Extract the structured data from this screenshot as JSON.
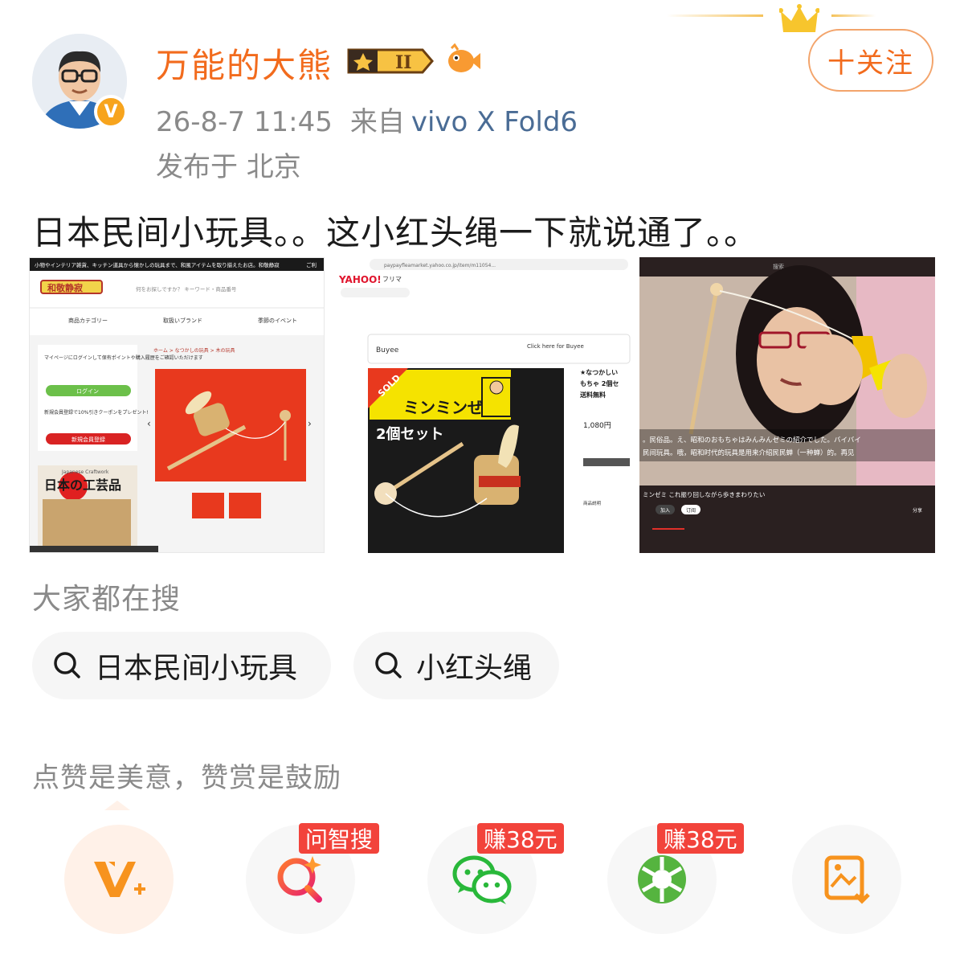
{
  "post": {
    "username": "万能的大熊",
    "level_label": "II",
    "time": "26-8-7 11:45",
    "source_prefix": "来自",
    "device": "vivo X Fold6",
    "location": "发布于 北京",
    "follow_label": "十关注",
    "content": "日本民间小玩具。。这小红头绳一下就说通了。。"
  },
  "images": {
    "img1": {
      "banner": "小物やインテリア雑貨、キッチン道具から懐かしの玩具まで、和風アイテムを取り揃えたお店。和敬静寂",
      "banner_right": "ご利",
      "store_name": "和敬静寂",
      "search_placeholder": "何をお探しですか？ キーワード・商品番号",
      "nav": [
        "商品カテゴリー",
        "取扱いブランド",
        "季節のイベント"
      ],
      "login_text": "マイページにログインして保有ポイントや購入履歴をご確認いただけます",
      "login_button": "ログイン",
      "coupon_text": "新規会員登録で10%引きクーポンをプレゼント!",
      "register_button": "新規会員登録",
      "breadcrumb": "ホーム > なつかしの玩具 > 木の玩具",
      "craft_title": "日本の工芸品",
      "craft_sub": "Japanese Craftwork"
    },
    "img2": {
      "url": "paypayfleamarket.yahoo.co.jp/item/m11054...",
      "logo": "YAHOO!",
      "logo_sub": "フリマ",
      "buyee_logo": "Buyee",
      "buyee_cta": "Click here for Buyee",
      "sold": "SOLD",
      "product_name": "ミンミンぜみ",
      "set_label": "2個セット",
      "title_lines": [
        "★なつかしい",
        "もちゃ 2個セ",
        "送料無料"
      ],
      "price": "1,080円",
      "desc_label": "商品説明"
    },
    "img3": {
      "top_label": "搜索",
      "subtitle_jp": "。民俗品。え、昭和のおもちゃはみんみんゼミの紹介でした。バイバイ",
      "subtitle_cn": "民间玩具。哦，昭和时代的玩具是用来介绍民民蝉（一种蝉）的。再见",
      "caption": "ミンゼミ これ振り回しながら歩きまわりたい",
      "buttons": [
        "加入",
        "订阅"
      ],
      "share": "分享"
    }
  },
  "search": {
    "title": "大家都在搜",
    "chips": [
      "日本民间小玩具",
      "小红头绳"
    ]
  },
  "reward": {
    "text": "点赞是美意，赞赏是鼓励"
  },
  "actions": {
    "tags": [
      "问智搜",
      "赚38元",
      "赚38元"
    ]
  },
  "colors": {
    "brand_orange": "#f26b1d",
    "tag_red": "#f2433b",
    "wechat_green": "#29b83a",
    "moments_green": "#55b43f"
  }
}
